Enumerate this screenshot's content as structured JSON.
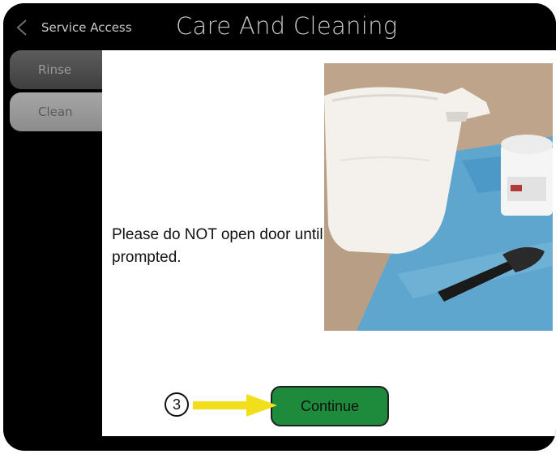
{
  "header": {
    "back_label": "Service Access",
    "title": "Care And Cleaning"
  },
  "sidebar": {
    "items": [
      {
        "label": "Rinse"
      },
      {
        "label": "Clean"
      }
    ]
  },
  "main": {
    "message": "Please do NOT open door until prompted.",
    "continue_label": "Continue"
  },
  "callout": {
    "number": "3",
    "arrow_color": "#f2df1b"
  },
  "colors": {
    "continue_button": "#1d8a3c",
    "frame": "#000000",
    "header_text": "#c9c9c9"
  },
  "icons": [
    "chevron-left-icon",
    "arrow-right-icon"
  ]
}
